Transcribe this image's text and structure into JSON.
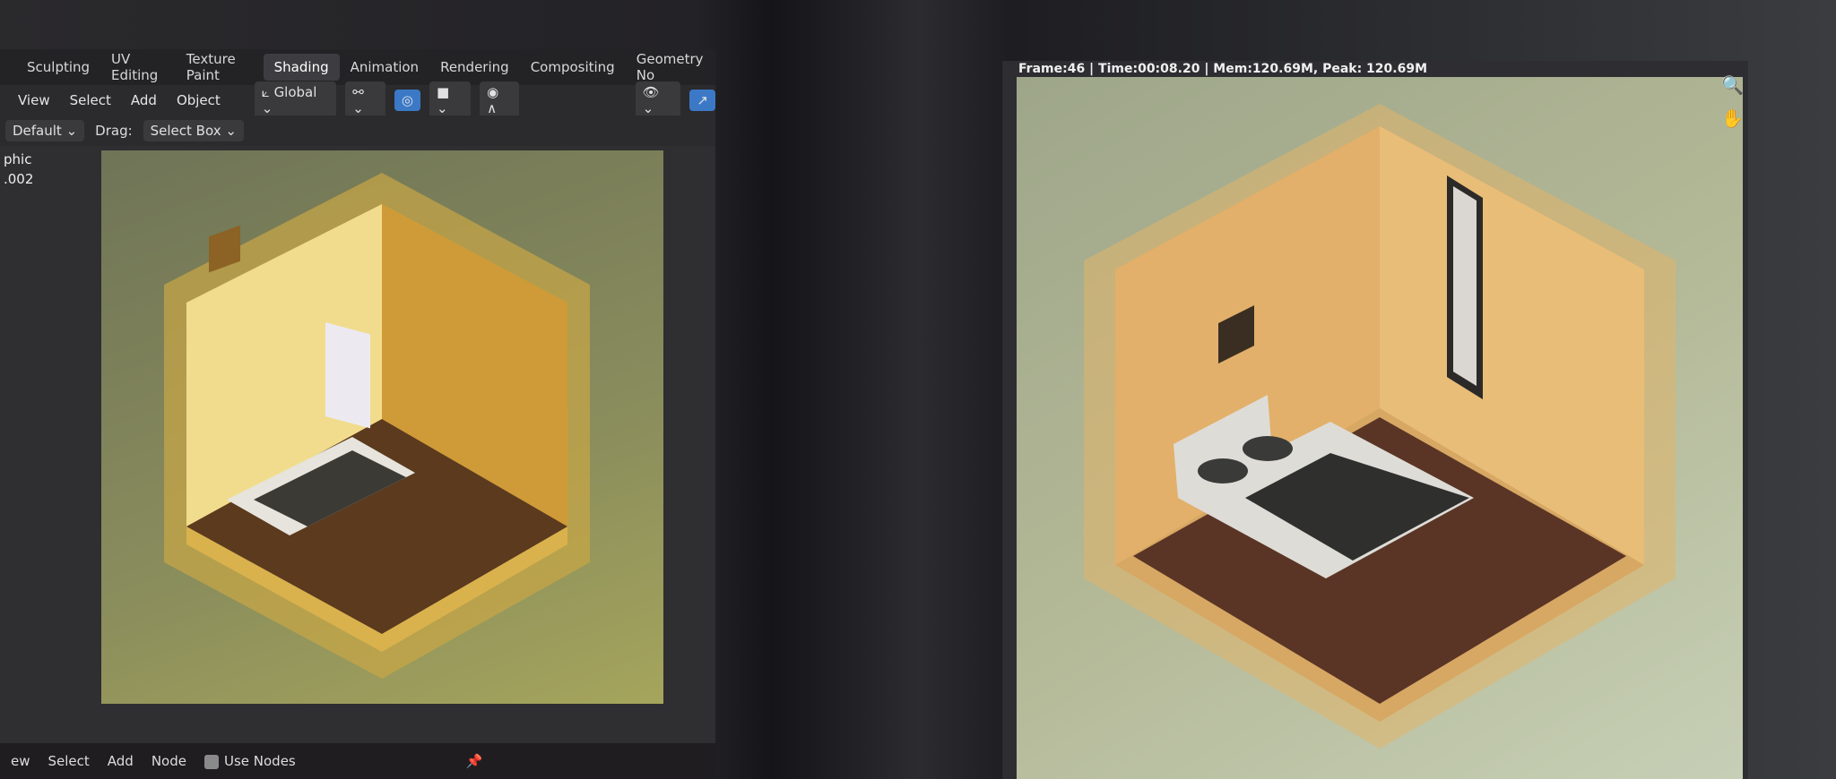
{
  "left_window": {
    "workspace_tabs": [
      "Sculpting",
      "UV Editing",
      "Texture Paint",
      "Shading",
      "Animation",
      "Rendering",
      "Compositing",
      "Geometry No"
    ],
    "active_tab": "Shading",
    "header_menus": [
      "View",
      "Select",
      "Add",
      "Object"
    ],
    "transform_orientation": "Global",
    "mode_select": "Default",
    "drag_label": "Drag:",
    "drag_value": "Select Box",
    "overlay_text": [
      "phic",
      ".002"
    ],
    "node_editor_menus": [
      "ew",
      "Select",
      "Add",
      "Node"
    ],
    "use_nodes_label": "Use Nodes",
    "use_nodes_checked": false
  },
  "right_window": {
    "render_status": "Frame:46 | Time:00:08.20 | Mem:120.69M, Peak: 120.69M",
    "icons": [
      "zoom-icon",
      "hand-pan-icon"
    ]
  },
  "colors": {
    "accent_blue": "#3b79c7",
    "wall": "#e2b46a",
    "floor": "#5a3526",
    "background": "#9ea68a"
  }
}
